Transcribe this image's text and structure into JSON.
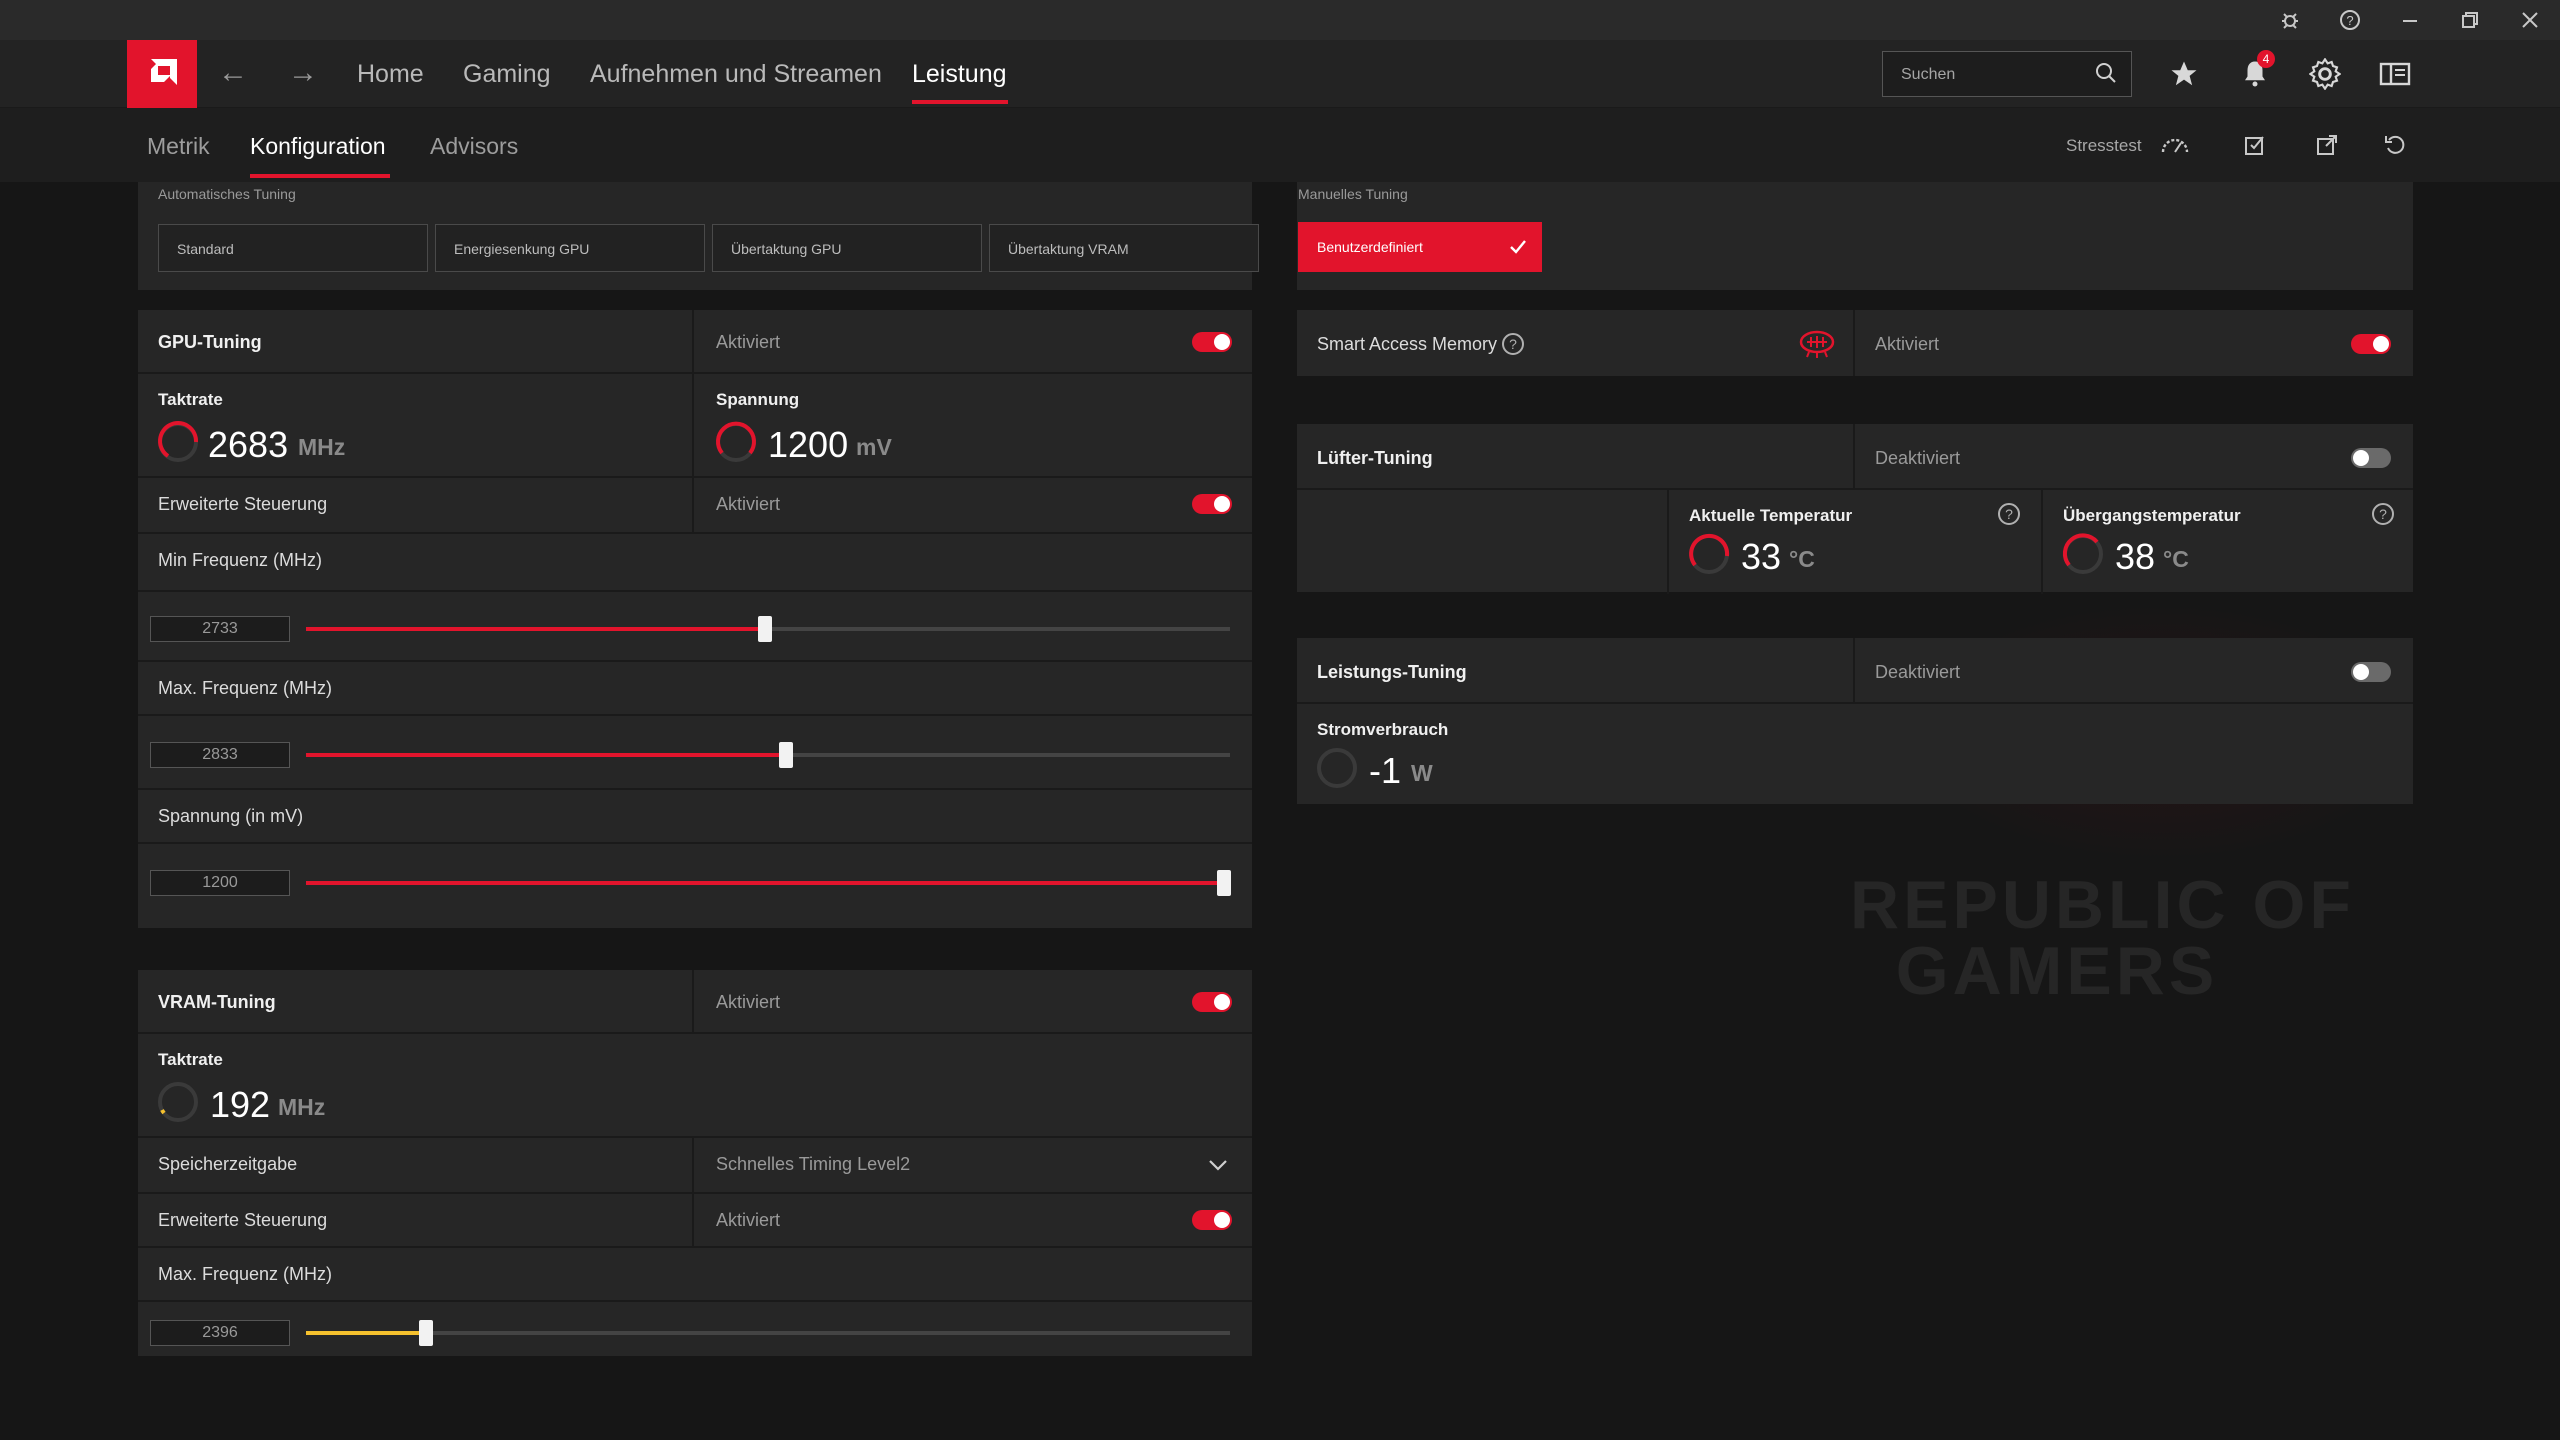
{
  "topnav": {
    "items": [
      "Home",
      "Gaming",
      "Aufnehmen und Streamen",
      "Leistung"
    ],
    "search_placeholder": "Suchen",
    "notification_count": "4"
  },
  "subnav": {
    "tabs": [
      "Metrik",
      "Konfiguration",
      "Advisors"
    ],
    "stresstest": "Stresstest"
  },
  "auto_tuning": {
    "label": "Automatisches Tuning",
    "buttons": [
      "Standard",
      "Energiesenkung GPU",
      "Übertaktung GPU",
      "Übertaktung VRAM"
    ]
  },
  "manual_tuning": {
    "label": "Manuelles Tuning",
    "button": "Benutzerdefiniert"
  },
  "gpu_tuning": {
    "title": "GPU-Tuning",
    "state": "Aktiviert",
    "enabled": true,
    "clock_label": "Taktrate",
    "clock_value": "2683",
    "clock_unit": "MHz",
    "voltage_label": "Spannung",
    "voltage_value": "1200",
    "voltage_unit": "mV",
    "advanced_label": "Erweiterte Steuerung",
    "advanced_state": "Aktiviert",
    "advanced_enabled": true,
    "sliders": [
      {
        "label": "Min Frequenz (MHz)",
        "value": "2733",
        "fraction": 0.497
      },
      {
        "label": "Max. Frequenz (MHz)",
        "value": "2833",
        "fraction": 0.52
      },
      {
        "label": "Spannung (in mV)",
        "value": "1200",
        "fraction": 0.993
      }
    ]
  },
  "vram_tuning": {
    "title": "VRAM-Tuning",
    "state": "Aktiviert",
    "enabled": true,
    "clock_label": "Taktrate",
    "clock_value": "192",
    "clock_unit": "MHz",
    "memory_timing_label": "Speicherzeitgabe",
    "memory_timing_value": "Schnelles Timing Level2",
    "advanced_label": "Erweiterte Steuerung",
    "advanced_state": "Aktiviert",
    "advanced_enabled": true,
    "slider": {
      "label": "Max. Frequenz (MHz)",
      "value": "2396",
      "fraction": 0.13
    }
  },
  "smart_access_memory": {
    "label": "Smart Access Memory",
    "state": "Aktiviert",
    "enabled": true
  },
  "fan_tuning": {
    "title": "Lüfter-Tuning",
    "state": "Deaktiviert",
    "enabled": false,
    "current_temp_label": "Aktuelle Temperatur",
    "current_temp_value": "33",
    "transition_temp_label": "Übergangstemperatur",
    "transition_temp_value": "38",
    "temp_unit": "°C"
  },
  "power_tuning": {
    "title": "Leistungs-Tuning",
    "state": "Deaktiviert",
    "enabled": false,
    "consumption_label": "Stromverbrauch",
    "consumption_value": "-1",
    "consumption_unit": "W"
  },
  "colors": {
    "accent": "#e2142c",
    "vram_slider": "#f5c12e"
  }
}
